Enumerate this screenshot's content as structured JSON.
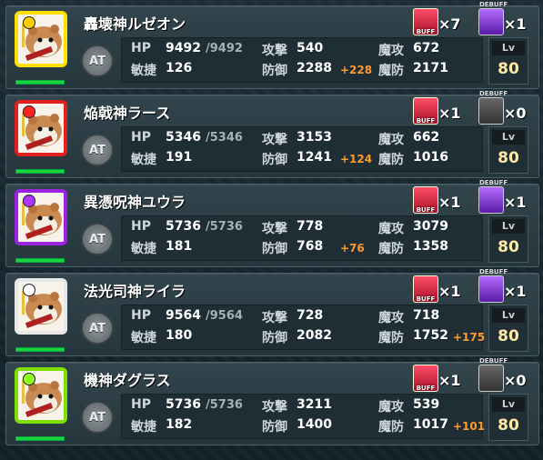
{
  "ui": {
    "at_label": "AT",
    "lv_label": "Lv",
    "labels": {
      "hp": "HP",
      "agi": "敏捷",
      "atk": "攻撃",
      "def": "防御",
      "matk": "魔攻",
      "mdef": "魔防"
    },
    "buff_tag": "BUFF",
    "debuff_tag": "DEBUFF"
  },
  "colors": {
    "hp_bar": "#1bd33b",
    "bonus": "#ff9a2e",
    "level": "#ffe9a6"
  },
  "units": [
    {
      "name": "轟壊神ルゼオン",
      "frame": "#ffe000",
      "badge": "#ffcc00",
      "hp": "9492",
      "max_hp": "/9492",
      "agi": "126",
      "atk": "540",
      "def": "2288",
      "def_bonus": "+228",
      "matk": "672",
      "mdef": "2171",
      "mdef_bonus": "",
      "buff_count": "×7",
      "debuff_count": "×1",
      "debuff_active": true,
      "level": "80"
    },
    {
      "name": "焔戟神ラース",
      "frame": "#e22020",
      "badge": "#ff2222",
      "hp": "5346",
      "max_hp": "/5346",
      "agi": "191",
      "atk": "3153",
      "def": "1241",
      "def_bonus": "+124",
      "matk": "662",
      "mdef": "1016",
      "mdef_bonus": "",
      "buff_count": "×1",
      "debuff_count": "×0",
      "debuff_active": false,
      "level": "80"
    },
    {
      "name": "異憑呪神ユウラ",
      "frame": "#9a22e0",
      "badge": "#b036ff",
      "hp": "5736",
      "max_hp": "/5736",
      "agi": "181",
      "atk": "778",
      "def": "768",
      "def_bonus": "+76",
      "matk": "3079",
      "mdef": "1358",
      "mdef_bonus": "",
      "buff_count": "×1",
      "debuff_count": "×1",
      "debuff_active": true,
      "level": "80"
    },
    {
      "name": "法光司神ライラ",
      "frame": "#e8e8e8",
      "badge": "#ffffff",
      "hp": "9564",
      "max_hp": "/9564",
      "agi": "180",
      "atk": "728",
      "def": "2082",
      "def_bonus": "",
      "matk": "718",
      "mdef": "1752",
      "mdef_bonus": "+175",
      "buff_count": "×1",
      "debuff_count": "×1",
      "debuff_active": true,
      "level": "80"
    },
    {
      "name": "機神ダグラス",
      "frame": "#7ee000",
      "badge": "#8cff20",
      "hp": "5736",
      "max_hp": "/5736",
      "agi": "182",
      "atk": "3211",
      "def": "1400",
      "def_bonus": "",
      "matk": "539",
      "mdef": "1017",
      "mdef_bonus": "+101",
      "buff_count": "×1",
      "debuff_count": "×0",
      "debuff_active": false,
      "level": "80"
    }
  ]
}
